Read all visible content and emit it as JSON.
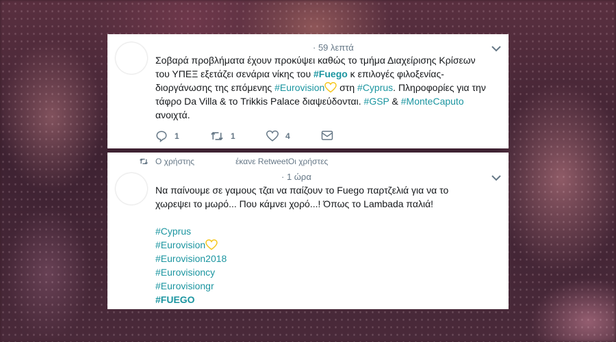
{
  "tweet1": {
    "timestamp": "· 59 λεπτά",
    "text_parts": [
      "Σοβαρά προβλήματα έχουν προκύψει καθώς το τμήμα Διαχείρισης Κρίσεων",
      "του ΥΠΕΞ εξετάζει σενάρια νίκης του ",
      "#Fuego",
      " κ επιλογές φιλοξενίας-",
      "διοργάνωσης της επόμενης ",
      "#Eurovision",
      " στη ",
      "#Cyprus",
      ". Πληροφορίες για την",
      "τάφρο Da Villa & το Trikkis Palace διαψεύδονται. ",
      "#GSP",
      " & ",
      "#MonteCaputo",
      "ανοιχτά."
    ],
    "actions": {
      "reply_count": "1",
      "retweet_count": "1",
      "like_count": "4"
    }
  },
  "tweet2": {
    "retweet_text": "Ο χρήστης",
    "retweet_text2": "έκανε RetweetΟι χρήστες",
    "timestamp": "· 1 ώρα",
    "text_line1": "Να παίνουμε σε γαμους τζαι να παίζουν το Fuego παρτζελιά για να το",
    "text_line2": "χωρεψει το μωρό... Που κάμνει χορό...! Όπως το Lambada παλιά!",
    "hashtags": [
      "#Cyprus",
      "#Eurovision",
      "#Eurovision2018",
      "#Eurovisioncy",
      "#Eurovisiongr",
      "#FUEGO"
    ]
  },
  "colors": {
    "link": "#1b95a0",
    "text": "#14171a",
    "muted": "#657786",
    "heart_emoji": "#f5c518"
  },
  "icons": [
    "caret-down-icon",
    "reply-icon",
    "retweet-icon",
    "like-icon",
    "direct-message-icon",
    "yellow-heart-icon"
  ]
}
